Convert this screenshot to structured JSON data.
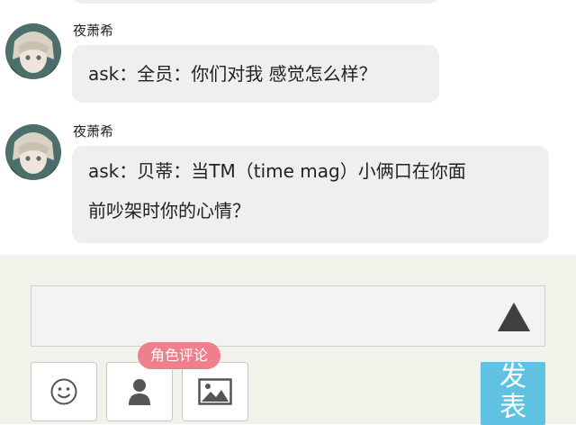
{
  "messages": [
    {
      "sender": "夜萧希",
      "text": "ask：全员：你们对我 感觉怎么样？"
    },
    {
      "sender": "夜萧希",
      "line1": "ask：贝蒂：当TM（time mag）小俩口在你面",
      "line2": "前吵架时你的心情？"
    }
  ],
  "compose": {
    "role_comment_label": "角色评论",
    "post_label": "发表",
    "icons": [
      "emoji-icon",
      "person-icon",
      "image-icon",
      "send-arrow-icon"
    ]
  },
  "colors": {
    "bubble": "#efefef",
    "panel": "#f3f2ea",
    "role_tag": "#f07f8c",
    "post_button": "#5fc2e2"
  }
}
